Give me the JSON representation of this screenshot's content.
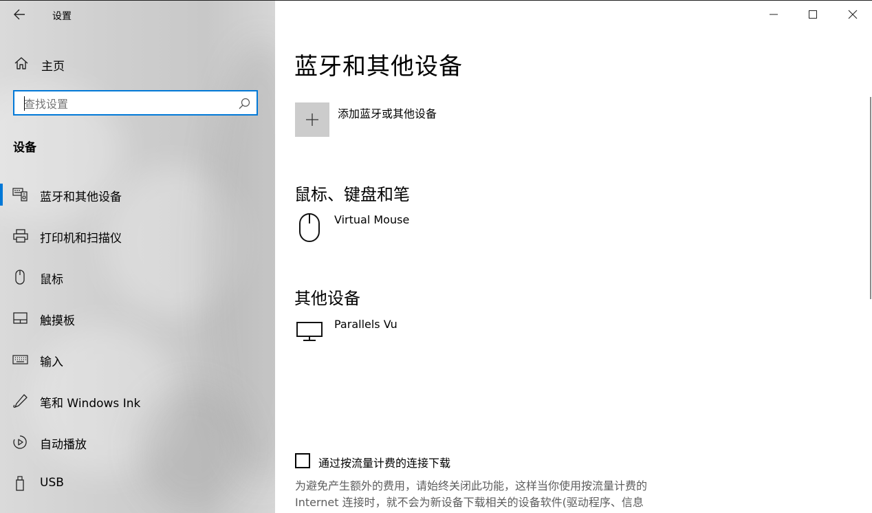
{
  "window": {
    "title": "设置",
    "controls": {
      "minimize_icon": "minimize-icon",
      "maximize_icon": "maximize-icon",
      "close_icon": "close-icon"
    }
  },
  "sidebar": {
    "home_label": "主页",
    "search": {
      "placeholder": "查找设置",
      "value": ""
    },
    "section_title": "设备",
    "items": [
      {
        "label": "蓝牙和其他设备",
        "icon": "bluetooth-devices-icon",
        "selected": true
      },
      {
        "label": "打印机和扫描仪",
        "icon": "printer-icon"
      },
      {
        "label": "鼠标",
        "icon": "mouse-icon"
      },
      {
        "label": "触摸板",
        "icon": "touchpad-icon"
      },
      {
        "label": "输入",
        "icon": "keyboard-icon"
      },
      {
        "label": "笔和 Windows Ink",
        "icon": "pen-icon"
      },
      {
        "label": "自动播放",
        "icon": "autoplay-icon"
      },
      {
        "label": "USB",
        "icon": "usb-icon"
      }
    ]
  },
  "main": {
    "title": "蓝牙和其他设备",
    "add_device_label": "添加蓝牙或其他设备",
    "sections": [
      {
        "title": "鼠标、键盘和笔",
        "devices": [
          {
            "name": "Virtual Mouse",
            "icon": "mouse-icon"
          }
        ]
      },
      {
        "title": "其他设备",
        "devices": [
          {
            "name": "Parallels Vu",
            "icon": "monitor-icon"
          }
        ]
      }
    ],
    "metered": {
      "checkbox_label": "通过按流量计费的连接下载",
      "checked": false,
      "description": "为避免产生额外的费用，请始终关闭此功能，这样当你使用按流量计费的 Internet 连接时，就不会为新设备下载相关的设备软件(驱动程序、信息"
    }
  },
  "colors": {
    "accent": "#0078d7",
    "sidebar_bg": "#d0d0d0",
    "add_tile": "#cccccc"
  }
}
